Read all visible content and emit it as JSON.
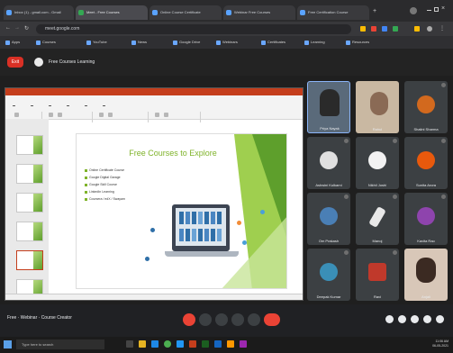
{
  "browser": {
    "tabs": [
      {
        "label": "Inbox (1) - gmail.com - Gmail"
      },
      {
        "label": "Meet - Free Courses"
      },
      {
        "label": "Online Course Certificate"
      },
      {
        "label": "Webinar Free Courses"
      },
      {
        "label": "Free Certification Course"
      }
    ],
    "url": "meet.google.com",
    "bookmarks": [
      "Apps",
      "Courses",
      "YouTube",
      "News",
      "Google Drive",
      "Webinars",
      "Certificates",
      "Learning",
      "Resources"
    ]
  },
  "meet": {
    "leave_label": "Exit",
    "meeting_name": "Free Courses Learning",
    "bottom_info": "Free · Webinar · Course Creator"
  },
  "presentation": {
    "slide_title": "Free Courses to Explore",
    "bullets": [
      "Online Certificate Course",
      "Google Digital Garage",
      "Google Skill Course",
      "LinkedIn Learning",
      "Coursera / edX / Swayam"
    ]
  },
  "participants": [
    {
      "name": "Priya Nayak"
    },
    {
      "name": "Rahul"
    },
    {
      "name": "Shalini Sharma"
    },
    {
      "name": "Ashwini Kulkarni"
    },
    {
      "name": "Nikhil Joshi"
    },
    {
      "name": "Sunita Arora"
    },
    {
      "name": "Om Prakash"
    },
    {
      "name": "Manoj"
    },
    {
      "name": "Kavita Rao"
    },
    {
      "name": "Deepak Kumar"
    },
    {
      "name": "Ravi"
    },
    {
      "name": "Anjali"
    }
  ],
  "taskbar": {
    "search_placeholder": "Type here to search",
    "time": "11:06 AM",
    "date": "06-05-2021"
  },
  "colors": {
    "accent_red": "#d93025",
    "slide_green": "#7fb32a",
    "active_tile": "#8ab4f8"
  }
}
